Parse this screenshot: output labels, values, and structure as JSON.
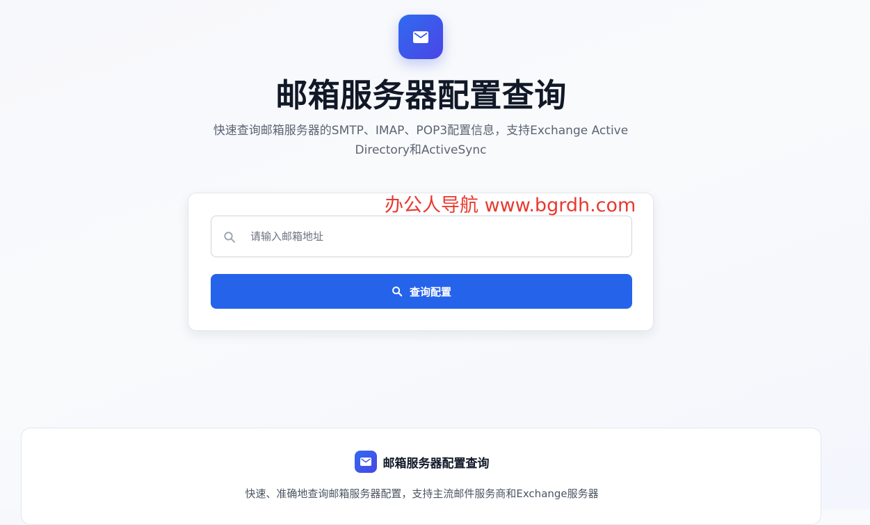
{
  "hero": {
    "icon": "mail-icon",
    "title": "邮箱服务器配置查询",
    "subtitle": "快速查询邮箱服务器的SMTP、IMAP、POP3配置信息，支持Exchange Active Directory和ActiveSync"
  },
  "watermark": {
    "text": "办公人导航  www.bgrdh.com"
  },
  "search": {
    "icon": "search-icon",
    "placeholder": "请输入邮箱地址",
    "value": "",
    "button_label": "查询配置",
    "button_icon": "search-icon"
  },
  "info": {
    "icon": "mail-icon",
    "title": "邮箱服务器配置查询",
    "description": "快速、准确地查询邮箱服务器配置，支持主流邮件服务商和Exchange服务器"
  },
  "colors": {
    "primary": "#2563eb",
    "gradient_start": "#2f6bf0",
    "gradient_end": "#4b45e6",
    "watermark": "#e8392f",
    "title": "#111827",
    "muted": "#5b6473"
  }
}
